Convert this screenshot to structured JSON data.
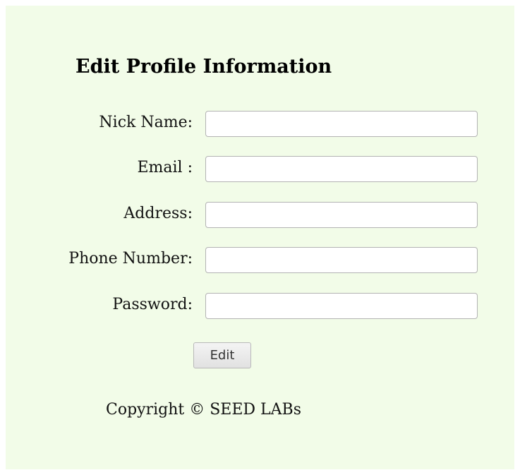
{
  "form": {
    "title": "Edit Profile Information",
    "fields": [
      {
        "label": "Nick Name:",
        "value": "",
        "placeholder": ""
      },
      {
        "label": "Email :",
        "value": "",
        "placeholder": ""
      },
      {
        "label": "Address:",
        "value": "",
        "placeholder": ""
      },
      {
        "label": "Phone Number:",
        "value": "",
        "placeholder": ""
      },
      {
        "label": "Password:",
        "value": "",
        "placeholder": ""
      }
    ],
    "submit_label": "Edit"
  },
  "footer": {
    "copyright": "Copyright © SEED LABs"
  },
  "colors": {
    "panel_background": "#f2fce8",
    "page_background": "#ffffff"
  }
}
